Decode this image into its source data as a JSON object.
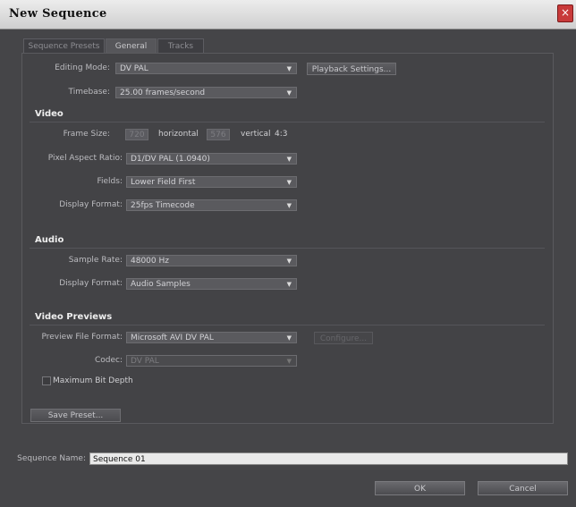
{
  "window": {
    "title": "New Sequence",
    "close_glyph": "×"
  },
  "tabs": [
    "Sequence Presets",
    "General",
    "Tracks"
  ],
  "general": {
    "editing_mode": {
      "label": "Editing Mode:",
      "value": "DV PAL"
    },
    "playback_settings_label": "Playback Settings...",
    "timebase": {
      "label": "Timebase:",
      "value": "25.00 frames/second"
    }
  },
  "video": {
    "heading": "Video",
    "frame_size": {
      "label": "Frame Size:",
      "horizontal": "720",
      "horizontal_label": "horizontal",
      "vertical": "576",
      "vertical_label": "vertical",
      "ratio": "4:3"
    },
    "pixel_aspect_ratio": {
      "label": "Pixel Aspect Ratio:",
      "value": "D1/DV PAL (1.0940)"
    },
    "fields": {
      "label": "Fields:",
      "value": "Lower Field First"
    },
    "display_format": {
      "label": "Display Format:",
      "value": "25fps Timecode"
    }
  },
  "audio": {
    "heading": "Audio",
    "sample_rate": {
      "label": "Sample Rate:",
      "value": "48000 Hz"
    },
    "display_format": {
      "label": "Display Format:",
      "value": "Audio Samples"
    }
  },
  "video_previews": {
    "heading": "Video Previews",
    "preview_file_format": {
      "label": "Preview File Format:",
      "value": "Microsoft AVI DV PAL"
    },
    "configure_label": "Configure...",
    "codec": {
      "label": "Codec:",
      "value": "DV PAL"
    },
    "max_bit_depth_label": "Maximum Bit Depth",
    "max_bit_depth_checked": false
  },
  "save_preset_label": "Save Preset...",
  "sequence_name": {
    "label": "Sequence Name:",
    "value": "Sequence 01"
  },
  "buttons": {
    "ok": "OK",
    "cancel": "Cancel"
  },
  "colors": {
    "background": "#454548",
    "titlebar": "#dcdcdc",
    "close": "#c83a3a",
    "name_field": "#e9e9e9"
  },
  "icons": {
    "dropdown": "chevron-down-icon",
    "close": "close-icon"
  }
}
